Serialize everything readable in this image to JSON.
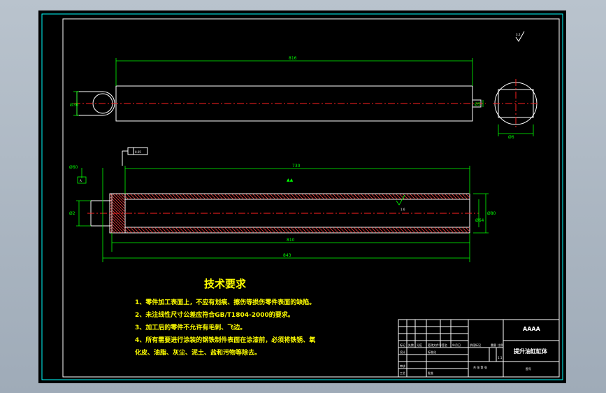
{
  "drawing": {
    "border_color": "#00ffff",
    "line_color": "#ffffff",
    "dimension_color": "#00ff00",
    "centerline_color": "#ff2020",
    "text_color": "#ffff00"
  },
  "dimensions": {
    "top_length": "816",
    "top_left_dia": "Ø30",
    "top_right_dia": "Ø5",
    "right_circle_dim": "Ø6",
    "section_inner_length": "730",
    "section_length": "810",
    "section_total_length": "843",
    "left_dia": "Ø60",
    "left_height": "Ø2",
    "right_dia_outer": "Ø80",
    "right_dia_inner": "Ø64",
    "tolerance_box": "0.05",
    "datum_label": "A",
    "roughness_corner": "3.2",
    "roughness_mid": "1.6",
    "center_mark": "▲▲"
  },
  "requirements": {
    "title": "技术要求",
    "lines": [
      "1、零件加工表面上，不应有划痕、擦伤等损伤零件表面的缺陷。",
      "2、未注线性尺寸公差应符合GB/T1804-2000的要求。",
      "3、加工后的零件不允许有毛刺、飞边。",
      "4、所有需要进行涂装的钢铁制件表面在涂漆前，必须将铁锈、氧",
      "化皮、油脂、灰尘、泥土、盐和污物等除去。"
    ]
  },
  "title_block": {
    "company": "AAAA",
    "part_name": "提升油缸缸体",
    "drawing_no_label": "图号",
    "scale": "1:1",
    "labels": {
      "mark": "标记",
      "count": "处数",
      "zone": "分区",
      "change_doc": "更改文件号",
      "sign": "签名",
      "date": "年月日",
      "design": "设计",
      "standardize": "标准化",
      "stage_mark": "阶段标记",
      "weight": "重量",
      "ratio": "比例",
      "review": "审核",
      "process": "工艺",
      "approve": "批准",
      "sheet": "共 张 第 张"
    }
  }
}
